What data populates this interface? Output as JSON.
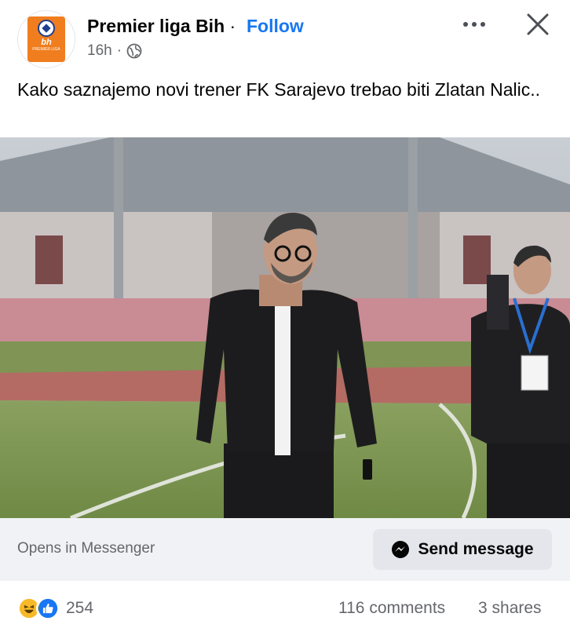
{
  "post": {
    "page_name": "Premier liga Bih",
    "separator": " ·",
    "follow_label": "Follow",
    "time": "16h",
    "meta_separator": "·",
    "privacy_icon": "globe-icon",
    "text": "Kako saznajemo novi trener FK Sarajevo trebao biti Zlatan Nalic..",
    "logo": {
      "top_text": "bh",
      "bottom_text": "PREMIER LIGA",
      "brand_color": "#f07d1e"
    }
  },
  "messenger": {
    "opens_in": "Opens in Messenger",
    "send_label": "Send message",
    "send_icon": "messenger-icon"
  },
  "engagement": {
    "reaction_icons": [
      "haha-reaction-icon",
      "like-reaction-icon"
    ],
    "reaction_count": "254",
    "comments": "116 comments",
    "shares": "3 shares"
  },
  "colors": {
    "accent": "#1877f2",
    "secondary_text": "#65676b",
    "bar_bg": "#f0f2f5"
  }
}
